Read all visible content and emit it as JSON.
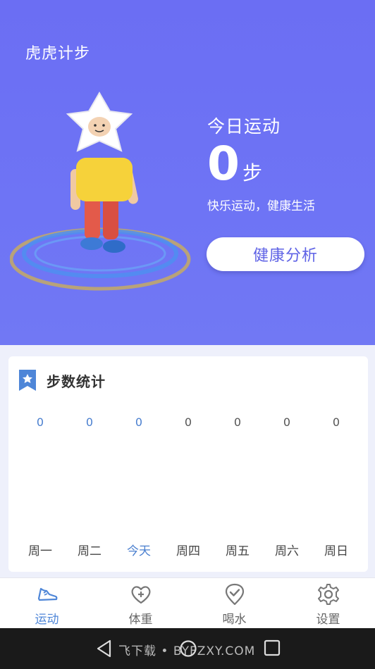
{
  "app": {
    "title": "虎虎计步"
  },
  "today": {
    "label": "今日运动",
    "steps": "0",
    "unit": "步",
    "slogan": "快乐运动，健康生活",
    "button": "健康分析"
  },
  "stats": {
    "title": "步数统计",
    "values": [
      "0",
      "0",
      "0",
      "0",
      "0",
      "0",
      "0"
    ],
    "days": [
      "周一",
      "周二",
      "今天",
      "周四",
      "周五",
      "周六",
      "周日"
    ]
  },
  "tabs": [
    {
      "label": "运动",
      "icon": "shoe-icon",
      "active": true
    },
    {
      "label": "体重",
      "icon": "heart-plus-icon",
      "active": false
    },
    {
      "label": "喝水",
      "icon": "check-pin-icon",
      "active": false
    },
    {
      "label": "设置",
      "icon": "gear-icon",
      "active": false
    }
  ],
  "system": {
    "watermark": "飞下载 • BYFZXY.COM"
  },
  "colors": {
    "accent": "#6b6ef3",
    "active_tab": "#4e86d8"
  }
}
